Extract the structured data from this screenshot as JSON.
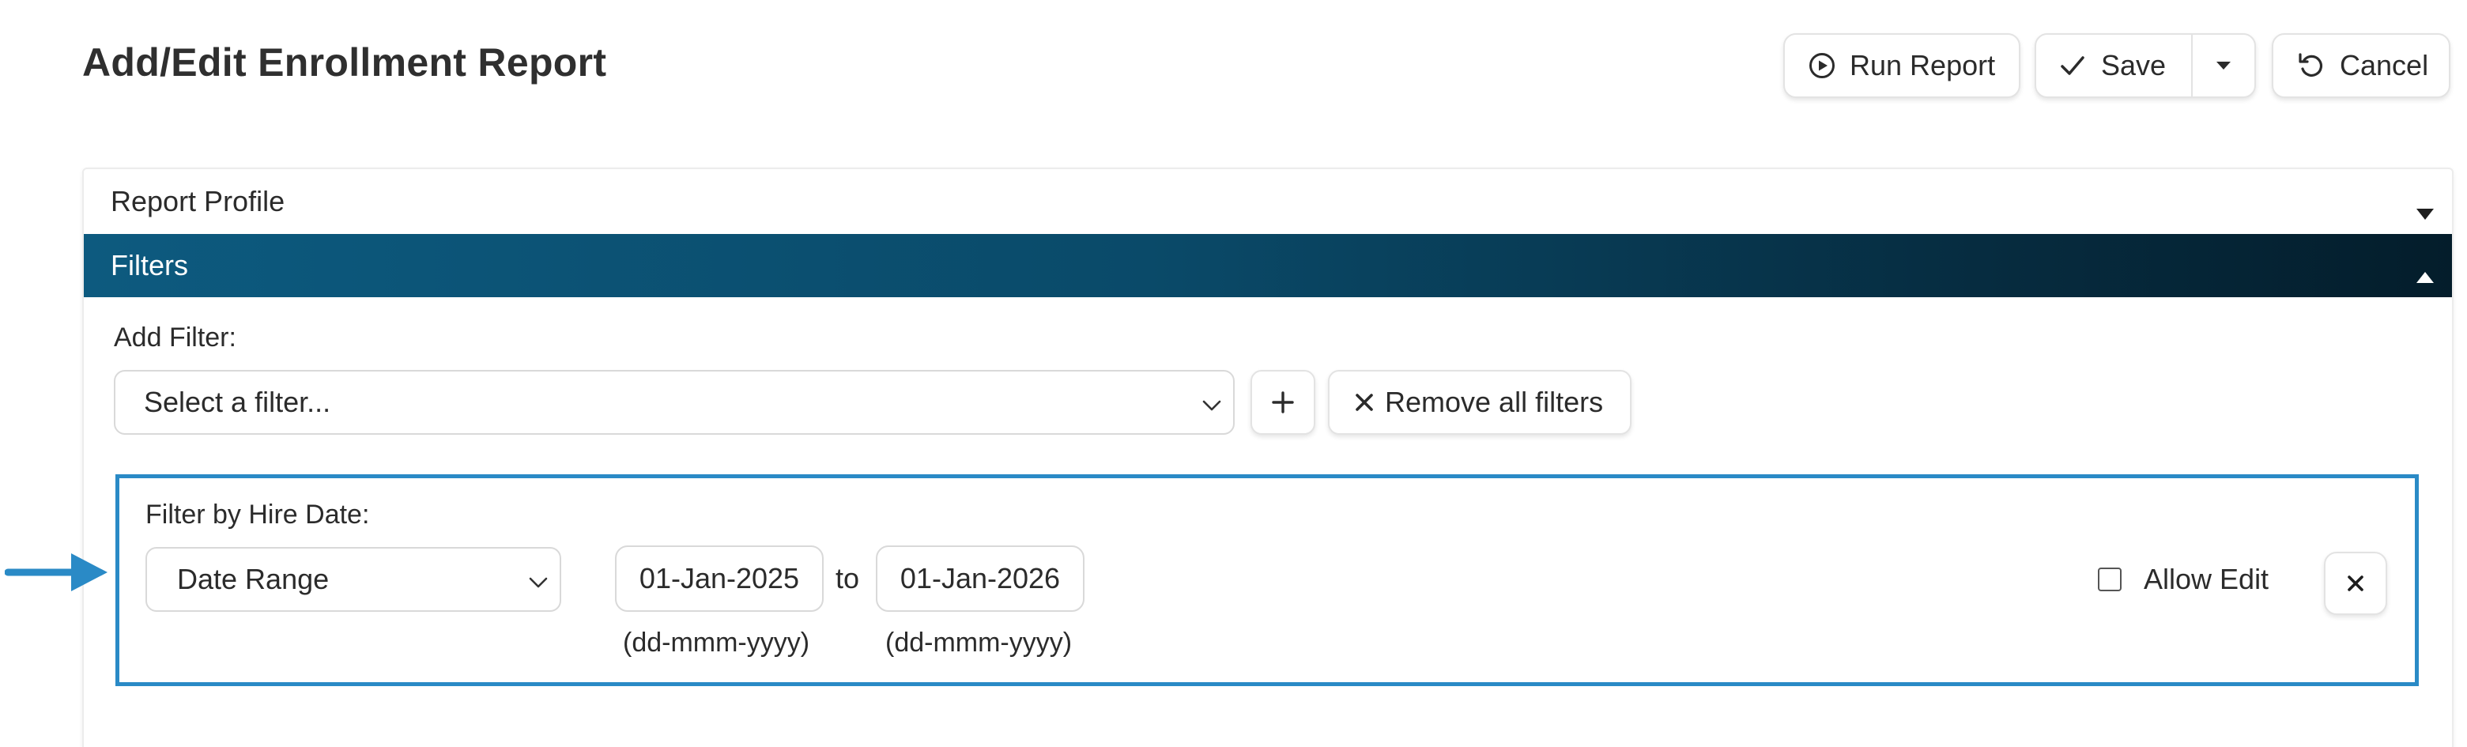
{
  "header": {
    "title": "Add/Edit Enrollment Report"
  },
  "toolbar": {
    "run_label": "Run Report",
    "save_label": "Save",
    "cancel_label": "Cancel"
  },
  "sections": {
    "profile_label": "Report Profile",
    "filters_label": "Filters"
  },
  "add_filter": {
    "label": "Add Filter:",
    "select_value": "Select a filter...",
    "remove_all_label": "Remove all filters"
  },
  "hire_date_filter": {
    "label": "Filter by Hire Date:",
    "mode_value": "Date Range",
    "from_value": "01-Jan-2025",
    "to_label": "to",
    "to_value": "01-Jan-2026",
    "format_hint_from": "(dd-mmm-yyyy)",
    "format_hint_to": "(dd-mmm-yyyy)",
    "allow_edit_label": "Allow Edit",
    "allow_edit_checked": false
  },
  "colors": {
    "filters_bar_start": "#0d5a7f",
    "filters_bar_end": "#041d2b",
    "highlight_border": "#2a8ac6",
    "arrow": "#2a8ac6"
  },
  "icons": {
    "run": "play-circle-icon",
    "save": "check-icon",
    "save_menu": "caret-down-icon",
    "cancel": "undo-icon",
    "add": "plus-icon",
    "remove_all": "close-icon",
    "remove_filter": "close-icon",
    "section_toggle": "triangle-icon",
    "pointer": "arrow-right-icon"
  }
}
